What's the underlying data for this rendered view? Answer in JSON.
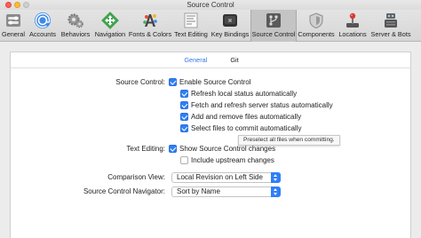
{
  "window": {
    "title": "Source Control"
  },
  "toolbar": {
    "items": [
      {
        "label": "General",
        "icon": "general-switch-icon"
      },
      {
        "label": "Accounts",
        "icon": "at-sign-icon"
      },
      {
        "label": "Behaviors",
        "icon": "gears-icon"
      },
      {
        "label": "Navigation",
        "icon": "navigation-arrows-icon"
      },
      {
        "label": "Fonts & Colors",
        "icon": "color-palette-icon"
      },
      {
        "label": "Text Editing",
        "icon": "text-editing-icon"
      },
      {
        "label": "Key Bindings",
        "icon": "keyboard-key-icon"
      },
      {
        "label": "Source Control",
        "icon": "source-control-icon",
        "selected": true
      },
      {
        "label": "Components",
        "icon": "shield-icon"
      },
      {
        "label": "Locations",
        "icon": "joystick-icon"
      },
      {
        "label": "Server & Bots",
        "icon": "server-icon"
      }
    ]
  },
  "tabs": [
    {
      "label": "General",
      "active": true
    },
    {
      "label": "Git",
      "active": false
    }
  ],
  "source_control": {
    "label": "Source Control:",
    "options": [
      {
        "label": "Enable Source Control",
        "checked": true
      },
      {
        "label": "Refresh local status automatically",
        "checked": true
      },
      {
        "label": "Fetch and refresh server status automatically",
        "checked": true
      },
      {
        "label": "Add and remove files automatically",
        "checked": true
      },
      {
        "label": "Select files to commit automatically",
        "checked": true
      }
    ]
  },
  "tooltip": {
    "text": "Preselect all files when committing."
  },
  "text_editing": {
    "label": "Text Editing:",
    "options": [
      {
        "label": "Show Source Control changes",
        "checked": true
      },
      {
        "label": "Include upstream changes",
        "checked": false
      }
    ]
  },
  "comparison_view": {
    "label": "Comparison View:",
    "value": "Local Revision on Left Side"
  },
  "navigator": {
    "label": "Source Control Navigator:",
    "value": "Sort by Name"
  },
  "colors": {
    "accent": "#2d7ff9",
    "tab_active": "#3477e0",
    "close": "#fc5f57",
    "minimize": "#fdbc2e"
  }
}
